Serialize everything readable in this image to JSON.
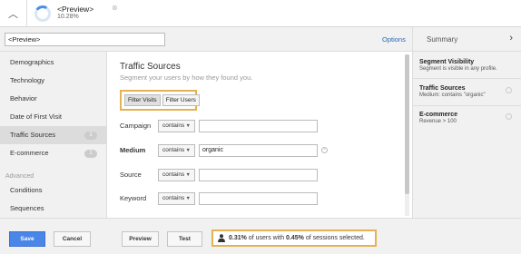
{
  "segment_card": {
    "name": "<Preview>",
    "percent": "10.28%"
  },
  "segment_name_input": {
    "value": "<Preview>"
  },
  "options_link": "Options",
  "sidebar": {
    "items": [
      {
        "label": "Demographics"
      },
      {
        "label": "Technology"
      },
      {
        "label": "Behavior"
      },
      {
        "label": "Date of First Visit"
      },
      {
        "label": "Traffic Sources",
        "badge": "1",
        "selected": true
      },
      {
        "label": "E-commerce",
        "badge": "1"
      }
    ],
    "advanced_heading": "Advanced",
    "advanced_items": [
      {
        "label": "Conditions"
      },
      {
        "label": "Sequences"
      }
    ]
  },
  "main": {
    "title": "Traffic Sources",
    "subtitle": "Segment your users by how they found you.",
    "filter_buttons": [
      {
        "label": "Filter Visits",
        "active": true
      },
      {
        "label": "Filter Users",
        "active": false
      }
    ],
    "rows": [
      {
        "label": "Campaign",
        "operator": "contains",
        "value": ""
      },
      {
        "label": "Medium",
        "operator": "contains",
        "value": "organic"
      },
      {
        "label": "Source",
        "operator": "contains",
        "value": ""
      },
      {
        "label": "Keyword",
        "operator": "contains",
        "value": ""
      }
    ]
  },
  "summary": {
    "title": "Summary",
    "items": [
      {
        "heading": "Segment Visibility",
        "detail": "Segment is visible in any profile."
      },
      {
        "heading": "Traffic Sources",
        "detail": "Medium: contains \"organic\""
      },
      {
        "heading": "E-commerce",
        "detail": "Revenue > 100"
      }
    ]
  },
  "footer": {
    "save": "Save",
    "cancel": "Cancel",
    "preview": "Preview",
    "test": "Test",
    "status": {
      "users_pct": "0.31%",
      "text1": " of users with ",
      "sessions_pct": "0.45%",
      "text2": " of sessions selected."
    }
  },
  "colors": {
    "accent": "#4a86e8",
    "highlight_border": "#e4b254",
    "link": "#2a66b8"
  }
}
